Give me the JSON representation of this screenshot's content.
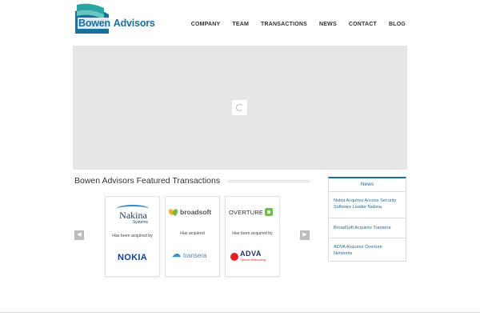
{
  "header": {
    "logo_word_1": "Bowen",
    "logo_word_2": "Advisors",
    "nav": [
      "COMPANY",
      "TEAM",
      "TRANSACTIONS",
      "NEWS",
      "CONTACT",
      "BLOG"
    ]
  },
  "featured": {
    "title": "Bowen Advisors Featured Transactions",
    "cards": [
      {
        "acquiree": "Nakina",
        "acquiree_sub": "Systems",
        "caption": "Has been acquired by",
        "acquirer": "NOKIA"
      },
      {
        "acquiree": "broadsoft",
        "caption": "Has acquired",
        "acquirer": "transera"
      },
      {
        "acquiree": "OVERTURE",
        "caption": "Has been acquired by",
        "acquirer": "ADVA",
        "acquirer_sub": "Optical Networking"
      }
    ]
  },
  "news": {
    "heading": "News",
    "items": [
      "Nokia Acquires Access Security Software Leader Nakina",
      "BroadSoft Acquires Transera",
      "ADVA Acquires Overture Networks"
    ]
  },
  "colors": {
    "brand": "#1d6f97",
    "slider_bg": "#e6e6e6"
  }
}
